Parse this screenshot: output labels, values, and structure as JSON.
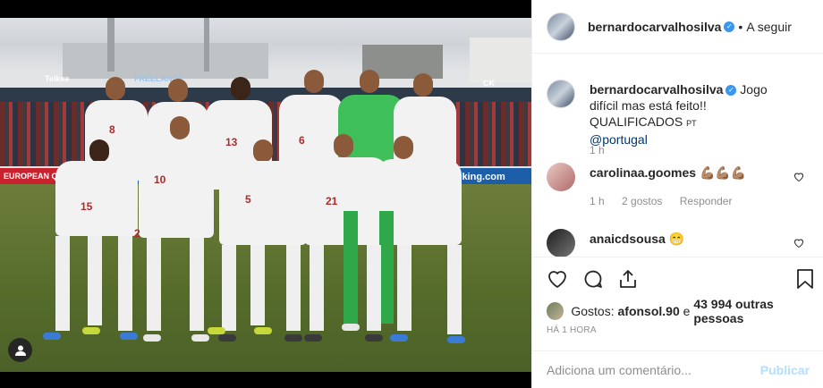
{
  "post": {
    "author": "bernardocarvalhosilva",
    "follow_label": "A seguir",
    "separator": "•",
    "verified_mark": "✓"
  },
  "photo": {
    "board_left": "Telkee",
    "board_mid": "FREELANCE",
    "board_right": "CK",
    "board_bottom": "ooking.com",
    "board_qualif": "EUROPEAN QUALIF",
    "numbers": [
      "8",
      "13",
      "6",
      "10",
      "5",
      "15",
      "21",
      "2"
    ]
  },
  "comments": [
    {
      "user": "bernardocarvalhosilva",
      "text": "Jogo difícil mas está feito!! QUALIFICADOS",
      "flag": "PT",
      "mention": "@portugal",
      "time": "1 h"
    },
    {
      "user": "carolinaa.goomes",
      "text": "💪🏽💪🏽💪🏽",
      "time": "1 h",
      "likes": "2 gostos",
      "reply": "Responder"
    },
    {
      "user": "anaicdsousa",
      "text": "😁"
    }
  ],
  "likes": {
    "prefix": "Gostos:",
    "first_user": "afonsol.90",
    "joiner": "e",
    "others": "43 994 outras pessoas"
  },
  "timestamp": "Há 1 hora",
  "add_comment": {
    "placeholder": "Adiciona um comentário...",
    "post_label": "Publicar"
  },
  "colors": {
    "link": "#00376b",
    "verified": "#3897f0",
    "muted": "#8e8e8e",
    "publish_disabled": "#b2dffc"
  },
  "icons": [
    "heart-icon",
    "comment-icon",
    "share-icon",
    "bookmark-icon",
    "user-tag-icon",
    "verified-icon"
  ]
}
